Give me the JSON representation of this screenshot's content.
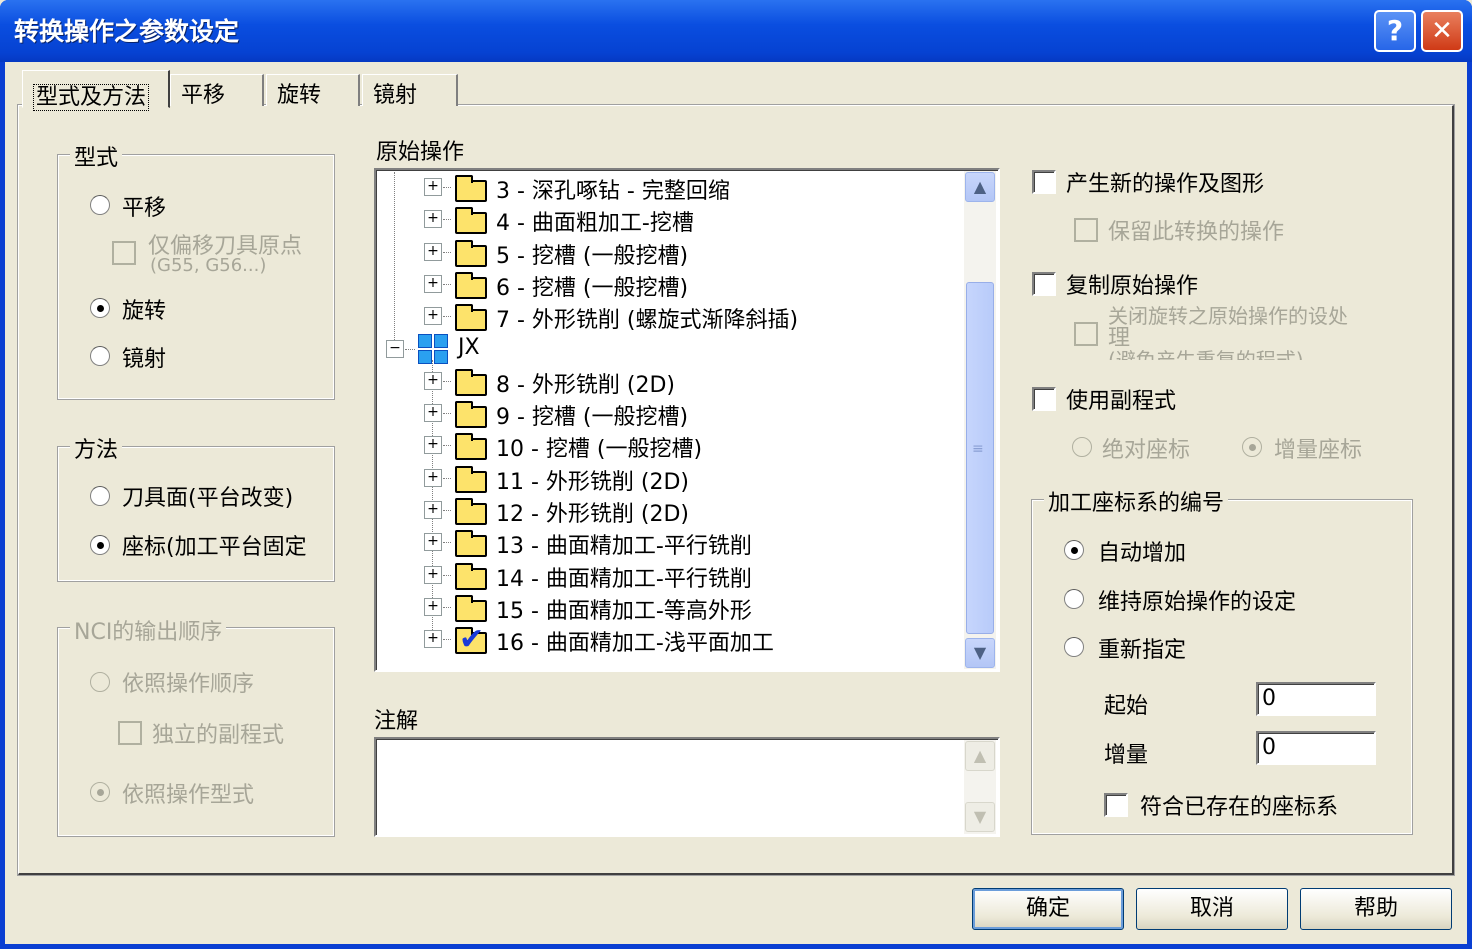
{
  "window": {
    "title": "转换操作之参数设定",
    "help_glyph": "?",
    "close_glyph": "✕"
  },
  "tabs": [
    "型式及方法",
    "平移",
    "旋转",
    "镜射"
  ],
  "type_group": {
    "title": "型式",
    "translate": "平移",
    "offset_origin_line1": "仅偏移刀具原点",
    "offset_origin_line2": "(G55, G56...)",
    "rotate": "旋转",
    "mirror": "镜射",
    "selected": "旋转"
  },
  "method_group": {
    "title": "方法",
    "tool_plane": "刀具面(平台改变)",
    "coordinate": "座标(加工平台固定",
    "selected": "座标(加工平台固定"
  },
  "nci_group": {
    "title": "NCI的输出顺序",
    "by_operation_order": "依照操作顺序",
    "independent_subprogram": "独立的副程式",
    "by_operation_type": "依照操作型式"
  },
  "source_ops": {
    "label": "原始操作",
    "items": [
      {
        "text": "3 - 深孔啄钻 - 完整回缩",
        "icon": "folder"
      },
      {
        "text": "4 - 曲面粗加工-挖槽",
        "icon": "folder"
      },
      {
        "text": "5 - 挖槽 (一般挖槽)",
        "icon": "folder"
      },
      {
        "text": "6 - 挖槽 (一般挖槽)",
        "icon": "folder"
      },
      {
        "text": "7 - 外形铣削 (螺旋式渐降斜插)",
        "icon": "folder"
      },
      {
        "text": "JX",
        "icon": "machine-group"
      },
      {
        "text": "8 - 外形铣削 (2D)",
        "icon": "folder"
      },
      {
        "text": "9 - 挖槽 (一般挖槽)",
        "icon": "folder"
      },
      {
        "text": "10 - 挖槽 (一般挖槽)",
        "icon": "folder"
      },
      {
        "text": "11 - 外形铣削 (2D)",
        "icon": "folder"
      },
      {
        "text": "12 - 外形铣削 (2D)",
        "icon": "folder"
      },
      {
        "text": "13 - 曲面精加工-平行铣削",
        "icon": "folder"
      },
      {
        "text": "14 - 曲面精加工-平行铣削",
        "icon": "folder"
      },
      {
        "text": "15 - 曲面精加工-等高外形",
        "icon": "folder"
      },
      {
        "text": "16 - 曲面精加工-浅平面加工",
        "icon": "folder-checked"
      }
    ]
  },
  "notes": {
    "label": "注解",
    "value": ""
  },
  "options": {
    "create_new_ops": "产生新的操作及图形",
    "keep_transform_ops": "保留此转换的操作",
    "copy_source_ops": "复制原始操作",
    "copy_sub_line1": "关闭旋转之原始操作的设处",
    "copy_sub_line2": "理",
    "copy_sub_line3": "(避免产生重复的程式)",
    "use_subprogram": "使用副程式",
    "absolute_coords": "绝对座标",
    "incremental_coords": "增量座标"
  },
  "work_offset": {
    "title": "加工座标系的编号",
    "auto_increment": "自动增加",
    "keep_original": "维持原始操作的设定",
    "reassign": "重新指定",
    "selected": "自动增加",
    "start_label": "起始",
    "start_value": "0",
    "increment_label": "增量",
    "increment_value": "0",
    "match_existing": "符合已存在的座标系"
  },
  "buttons": {
    "ok": "确定",
    "cancel": "取消",
    "help": "帮助"
  },
  "colors": {
    "titlebar": "#0a4ee0",
    "face": "#ece9d8",
    "disabled_text": "#a7a698",
    "check_blue": "#1a3ad8"
  }
}
